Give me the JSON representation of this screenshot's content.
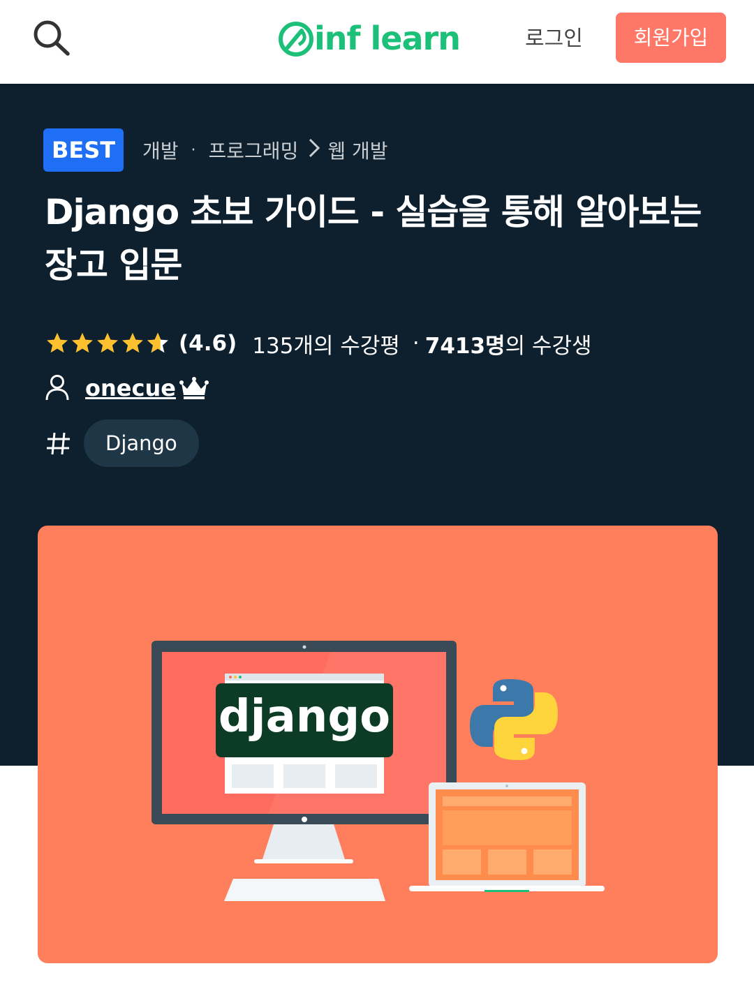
{
  "header": {
    "logo_text": "inf learn",
    "login_label": "로그인",
    "signup_label": "회원가입",
    "brand_color": "#1dc078",
    "signup_color": "#ff7867"
  },
  "course": {
    "badge": "BEST",
    "breadcrumb": {
      "category": "개발",
      "separator": "·",
      "subcategory": "프로그래밍",
      "current": "웹 개발"
    },
    "title": "Django 초보 가이드 - 실습을 통해 알아보는 장고 입문",
    "rating": {
      "stars": 4.6,
      "value_text": "(4.6)",
      "review_text": "135개의 수강평",
      "dot": "·",
      "student_count": "7413명",
      "student_suffix": "의 수강생"
    },
    "instructor": "onecue",
    "tags": [
      "Django"
    ]
  },
  "thumbnail": {
    "brand_word": "django",
    "background_color": "#ff7f5c"
  }
}
